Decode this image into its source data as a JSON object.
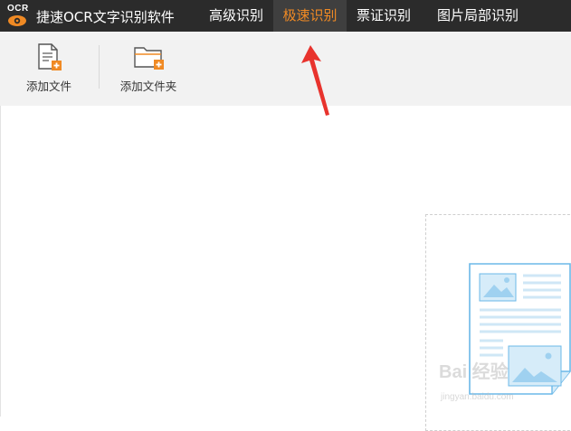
{
  "app": {
    "logo_text": "OCR",
    "title": "捷速OCR文字识别软件"
  },
  "nav": {
    "tabs": [
      {
        "label": "高级识别",
        "active": false
      },
      {
        "label": "极速识别",
        "active": true
      },
      {
        "label": "票证识别",
        "active": false
      },
      {
        "label": "图片局部识别",
        "active": false
      }
    ]
  },
  "toolbar": {
    "add_file_label": "添加文件",
    "add_folder_label": "添加文件夹"
  },
  "watermark": {
    "text": "Bai 经验",
    "sub": "jingyan.baidu.com"
  },
  "icons": {
    "logo": "ocr-eye-icon",
    "add_file": "add-file-icon",
    "add_folder": "add-folder-icon",
    "drop_illustration": "document-image-icon",
    "annotation": "red-arrow"
  },
  "colors": {
    "titlebar_bg": "#2b2b2b",
    "active_tab_text": "#f08a24",
    "accent_orange": "#f08a24",
    "toolbar_bg": "#f2f2f2",
    "illustration_blue": "#6bb8e8",
    "arrow_red": "#e8332d"
  }
}
